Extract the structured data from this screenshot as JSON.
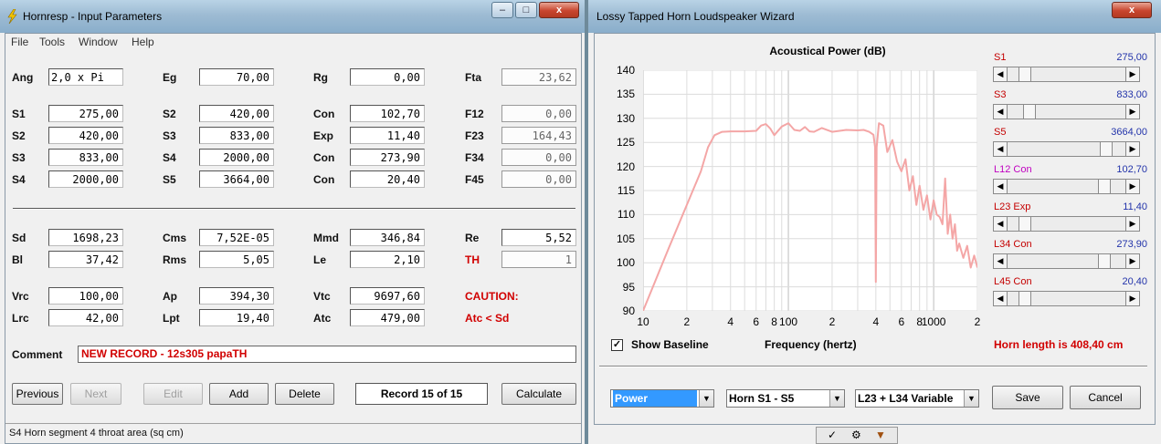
{
  "left_window": {
    "title": "Hornresp - Input Parameters",
    "menu": [
      "File",
      "Tools",
      "Window",
      "Help"
    ],
    "params": {
      "ang": {
        "label": "Ang",
        "value": "2,0 x Pi"
      },
      "eg": {
        "label": "Eg",
        "value": "70,00"
      },
      "rg": {
        "label": "Rg",
        "value": "0,00"
      },
      "fta": {
        "label": "Fta",
        "value": "23,62"
      },
      "s1": {
        "label": "S1",
        "value": "275,00"
      },
      "s2a": {
        "label": "S2",
        "value": "420,00"
      },
      "con1": {
        "label": "Con",
        "value": "102,70"
      },
      "f12": {
        "label": "F12",
        "value": "0,00"
      },
      "s2": {
        "label": "S2",
        "value": "420,00"
      },
      "s3a": {
        "label": "S3",
        "value": "833,00"
      },
      "exp": {
        "label": "Exp",
        "value": "11,40"
      },
      "f23": {
        "label": "F23",
        "value": "164,43"
      },
      "s3": {
        "label": "S3",
        "value": "833,00"
      },
      "s4a": {
        "label": "S4",
        "value": "2000,00"
      },
      "con2": {
        "label": "Con",
        "value": "273,90"
      },
      "f34": {
        "label": "F34",
        "value": "0,00"
      },
      "s4": {
        "label": "S4",
        "value": "2000,00"
      },
      "s5": {
        "label": "S5",
        "value": "3664,00"
      },
      "con3": {
        "label": "Con",
        "value": "20,40"
      },
      "f45": {
        "label": "F45",
        "value": "0,00"
      },
      "sd": {
        "label": "Sd",
        "value": "1698,23"
      },
      "cms": {
        "label": "Cms",
        "value": "7,52E-05"
      },
      "mmd": {
        "label": "Mmd",
        "value": "346,84"
      },
      "re": {
        "label": "Re",
        "value": "5,52"
      },
      "bl": {
        "label": "Bl",
        "value": "37,42"
      },
      "rms": {
        "label": "Rms",
        "value": "5,05"
      },
      "le": {
        "label": "Le",
        "value": "2,10"
      },
      "th": {
        "label": "TH",
        "value": "1"
      },
      "vrc": {
        "label": "Vrc",
        "value": "100,00"
      },
      "ap": {
        "label": "Ap",
        "value": "394,30"
      },
      "vtc": {
        "label": "Vtc",
        "value": "9697,60"
      },
      "lrc": {
        "label": "Lrc",
        "value": "42,00"
      },
      "lpt": {
        "label": "Lpt",
        "value": "19,40"
      },
      "atc": {
        "label": "Atc",
        "value": "479,00"
      }
    },
    "caution": "CAUTION:",
    "caution_detail": "Atc < Sd",
    "comment_label": "Comment",
    "comment_value": "NEW RECORD - 12s305 papaTH",
    "buttons": {
      "previous": "Previous",
      "next": "Next",
      "edit": "Edit",
      "add": "Add",
      "delete": "Delete",
      "calculate": "Calculate"
    },
    "record": "Record 15 of 15",
    "status": "S4   Horn segment 4 throat area  (sq cm)"
  },
  "right_window": {
    "title": "Lossy Tapped Horn Loudspeaker Wizard",
    "close_glyph": "x",
    "chart_data": {
      "type": "line",
      "title": "Acoustical Power (dB)",
      "xlabel": "Frequency (hertz)",
      "ylabel": "",
      "xscale": "log",
      "xlim": [
        10,
        2000
      ],
      "ylim": [
        90,
        140
      ],
      "yticks": [
        "140",
        "135",
        "130",
        "125",
        "120",
        "115",
        "110",
        "105",
        "100",
        "95",
        "90"
      ],
      "xticks": [
        {
          "f": 10,
          "label": "10"
        },
        {
          "f": 20,
          "label": "2"
        },
        {
          "f": 40,
          "label": "4"
        },
        {
          "f": 60,
          "label": "6"
        },
        {
          "f": 80,
          "label": "8"
        },
        {
          "f": 100,
          "label": "100"
        },
        {
          "f": 200,
          "label": "2"
        },
        {
          "f": 400,
          "label": "4"
        },
        {
          "f": 600,
          "label": "6"
        },
        {
          "f": 800,
          "label": "8"
        },
        {
          "f": 1000,
          "label": "1000"
        },
        {
          "f": 2000,
          "label": "2"
        }
      ],
      "grid": true,
      "line_color": "#f4a6a6",
      "series": [
        {
          "x": [
            10,
            15,
            20,
            25,
            28,
            31,
            35,
            40,
            50,
            60,
            65,
            70,
            75,
            80,
            90,
            100,
            110,
            120,
            130,
            140,
            150,
            170,
            200,
            250,
            300,
            330,
            360,
            385,
            395,
            400,
            405,
            420,
            450,
            480,
            520,
            560,
            600,
            640,
            680,
            720,
            760,
            800,
            850,
            900,
            950,
            1000,
            1050,
            1100,
            1150,
            1200,
            1250,
            1300,
            1350,
            1400,
            1450,
            1500,
            1600,
            1700,
            1800,
            1900,
            2000
          ],
          "y": [
            90,
            103,
            112,
            119,
            124,
            126.5,
            127.2,
            127.3,
            127.3,
            127.4,
            128.5,
            128.8,
            127.9,
            126.5,
            128.3,
            129.0,
            127.6,
            127.4,
            128.2,
            127.3,
            127.2,
            128.0,
            127.2,
            127.6,
            127.5,
            127.6,
            127.2,
            126.6,
            124.0,
            96.0,
            124.0,
            129.0,
            128.5,
            123.0,
            125.5,
            121.0,
            119.0,
            121.5,
            115.0,
            118.0,
            112.0,
            116.0,
            111.0,
            114.0,
            109.0,
            113.0,
            110.0,
            109.5,
            108.0,
            117.5,
            106.0,
            110.0,
            105.0,
            108.0,
            102.5,
            104.0,
            101.0,
            103.5,
            99.0,
            101.5,
            99.0
          ]
        }
      ]
    },
    "show_baseline": "Show Baseline",
    "show_baseline_checked": true,
    "horn_length": "Horn length is 408,40 cm",
    "sliders": [
      {
        "name": "S1",
        "label": "S1",
        "value": "275,00",
        "pos": 0.1,
        "color": "red"
      },
      {
        "name": "S3",
        "label": "S3",
        "value": "833,00",
        "pos": 0.15,
        "color": "red"
      },
      {
        "name": "S5",
        "label": "S5",
        "value": "3664,00",
        "pos": 0.88,
        "color": "red"
      },
      {
        "name": "L12",
        "label": "L12  Con",
        "value": "102,70",
        "pos": 0.86,
        "color": "magenta"
      },
      {
        "name": "L23",
        "label": "L23  Exp",
        "value": "11,40",
        "pos": 0.1,
        "color": "red"
      },
      {
        "name": "L34",
        "label": "L34  Con",
        "value": "273,90",
        "pos": 0.86,
        "color": "red"
      },
      {
        "name": "L45",
        "label": "L45  Con",
        "value": "20,40",
        "pos": 0.1,
        "color": "red"
      }
    ],
    "combo_power": "Power",
    "combo_horn": "Horn S1 - S5",
    "combo_variable": "L23 + L34 Variable",
    "save": "Save",
    "cancel": "Cancel"
  }
}
